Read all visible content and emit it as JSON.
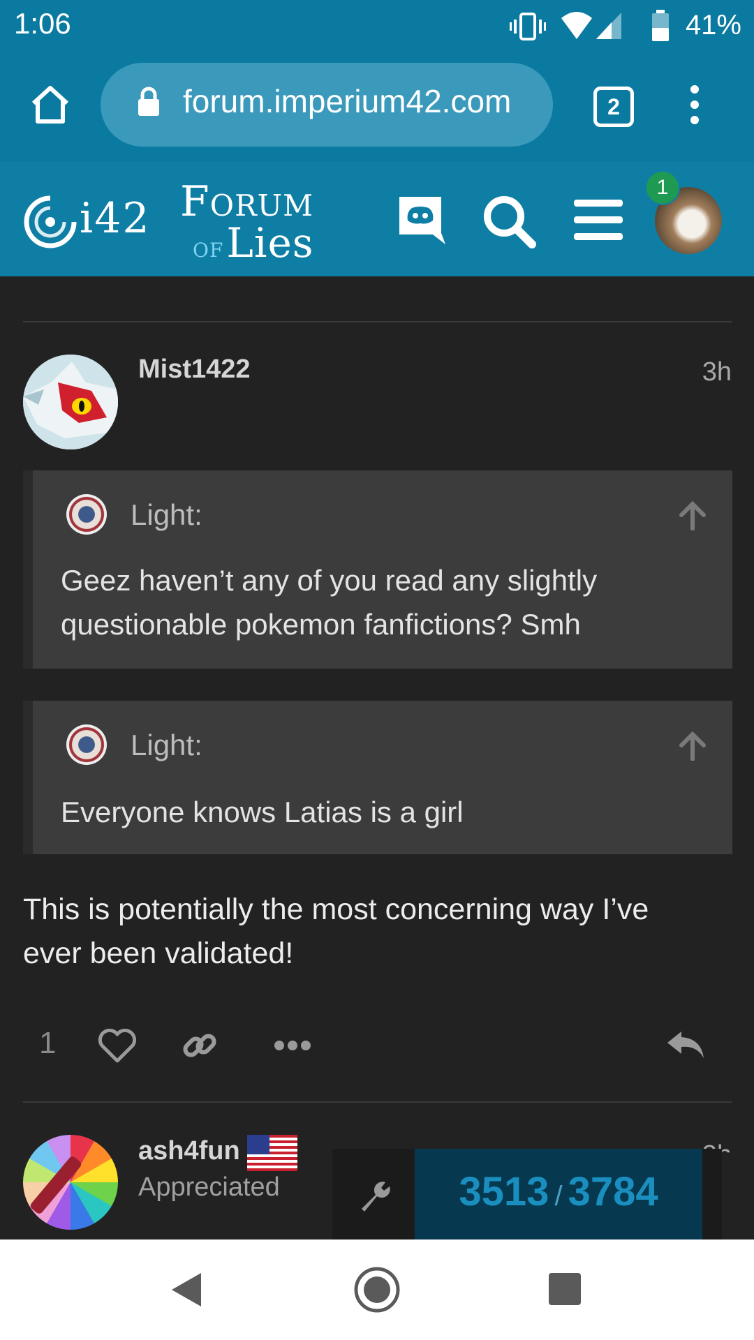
{
  "status_bar": {
    "time": "1:06",
    "battery": "41%",
    "icons": [
      "vibrate-icon",
      "wifi-icon",
      "signal-icon",
      "battery-icon"
    ]
  },
  "browser": {
    "url": "forum.imperium42.com",
    "tab_count": "2",
    "icons": [
      "home-icon",
      "lock-icon",
      "tabs-icon",
      "overflow-menu-icon"
    ]
  },
  "forum_header": {
    "logo_i42": "i42",
    "logo_forum": "Forum",
    "logo_of": "of",
    "logo_lies": "Lies",
    "notification_count": "1",
    "icons": [
      "discord-icon",
      "search-icon",
      "hamburger-menu-icon",
      "user-avatar"
    ]
  },
  "post": {
    "username": "Mist1422",
    "time": "3h",
    "quotes": [
      {
        "author": "Light:",
        "text": "Geez haven’t any of you read any slightly questionable pokemon fanfictions? Smh"
      },
      {
        "author": "Light:",
        "text": "Everyone knows Latias is a girl"
      }
    ],
    "body": "This is potentially the most concerning way I’ve ever been validated!",
    "likes": "1",
    "icons": [
      "heart-icon",
      "link-icon",
      "more-icon",
      "reply-icon"
    ]
  },
  "next_post": {
    "username": "ash4fun",
    "user_title": "Appreciated",
    "time": "3h",
    "flag": "us-flag-icon"
  },
  "progress": {
    "current": "3513",
    "separator": "/",
    "total": "3784",
    "fraction": 0.928
  },
  "colors": {
    "header_blue": "#0f7ea5",
    "status_blue": "#0a7aa1",
    "background": "#222222",
    "quote_bg": "#3c3c3c",
    "progress_text": "#1a8fbf"
  }
}
